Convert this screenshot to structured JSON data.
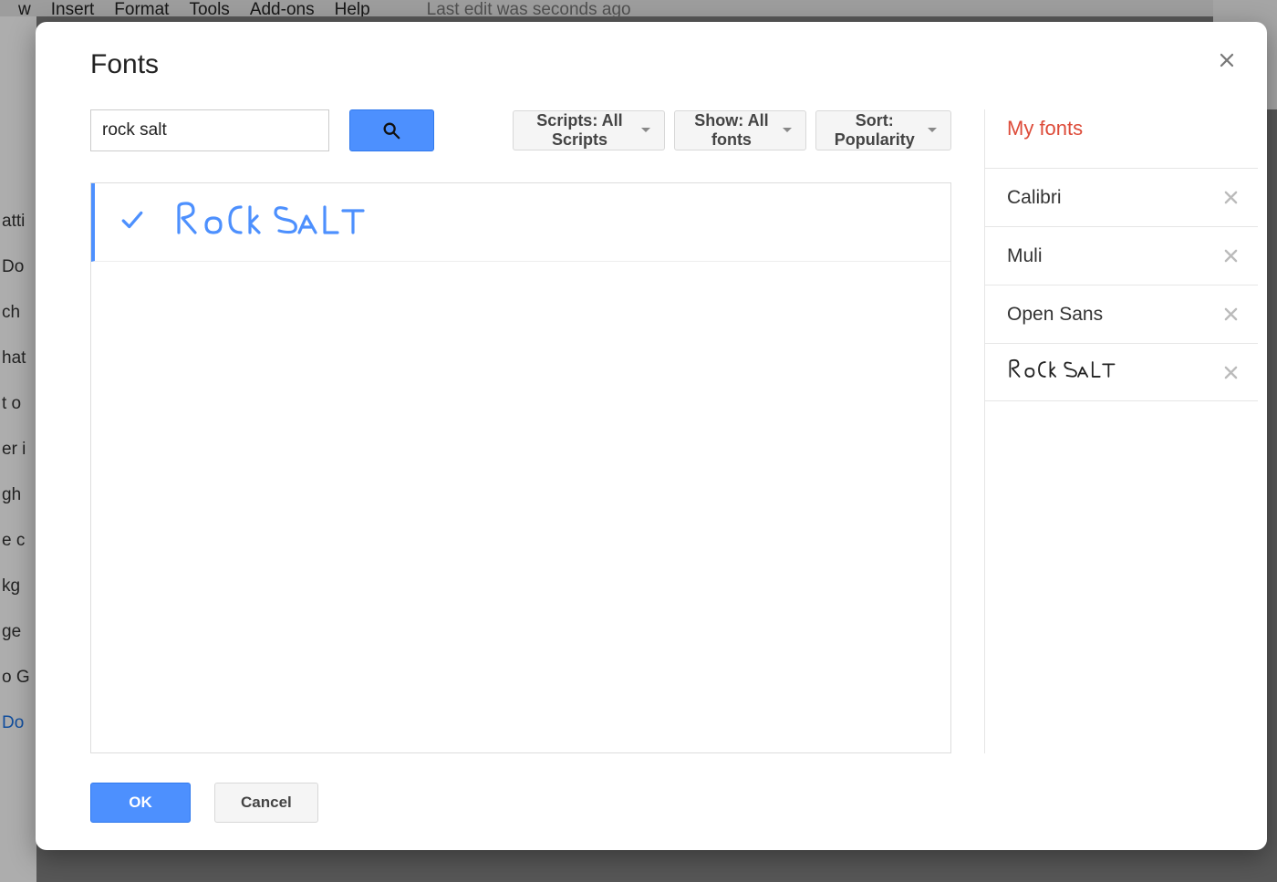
{
  "background": {
    "menu": [
      "w",
      "Insert",
      "Format",
      "Tools",
      "Add-ons",
      "Help"
    ],
    "last_edit": "Last edit was seconds ago",
    "left_fragments": [
      "atti",
      "Do",
      "ch",
      "hat",
      "t o",
      "er i",
      "",
      "gh",
      "e c",
      "kg",
      "ge",
      "o G",
      "Do"
    ]
  },
  "dialog": {
    "title": "Fonts",
    "search_value": "rock salt",
    "filters": {
      "scripts": {
        "prefix": "Scripts:",
        "value": "All Scripts"
      },
      "show": {
        "prefix": "Show:",
        "value": "All fonts"
      },
      "sort": {
        "prefix": "Sort:",
        "value": "Popularity"
      }
    },
    "results": [
      {
        "name": "Rock Salt",
        "checked": true
      }
    ],
    "my_fonts_title": "My fonts",
    "my_fonts": [
      {
        "name": "Calibri",
        "style": "plain"
      },
      {
        "name": "Muli",
        "style": "plain"
      },
      {
        "name": "Open Sans",
        "style": "plain"
      },
      {
        "name": "Rock Salt",
        "style": "rocksalt"
      }
    ],
    "ok": "OK",
    "cancel": "Cancel"
  }
}
